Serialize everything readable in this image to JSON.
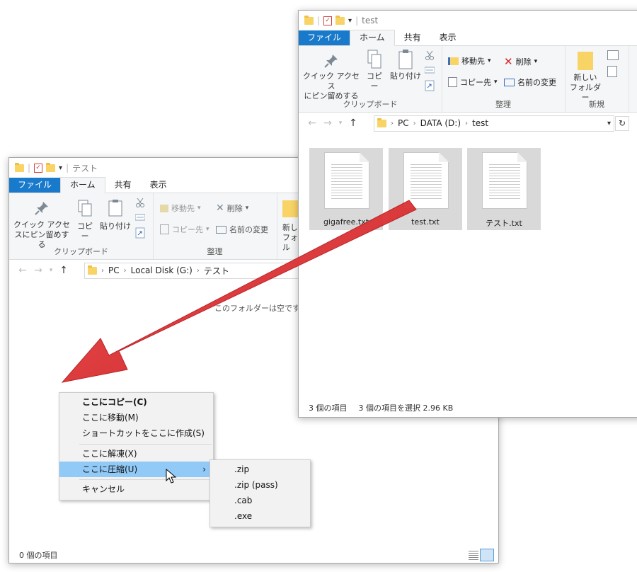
{
  "colors": {
    "file_tab": "#1979ca",
    "highlight": "#91c9f7",
    "arrow": "#e0262b",
    "folder": "#f8d467"
  },
  "back": {
    "title": "テスト",
    "tabs": [
      "ファイル",
      "ホーム",
      "共有",
      "表示"
    ],
    "ribbon": {
      "pin_label": "クイック アクセスにピン留めする",
      "copy_label": "コピー",
      "paste_label": "貼り付け",
      "clipboard_group": "クリップボード",
      "move_to": "移動先",
      "copy_to": "コピー先",
      "delete": "削除",
      "rename": "名前の変更",
      "organize_group": "整理",
      "new_folder_partial": "新し",
      "new_folder_partial2": "フォル"
    },
    "breadcrumb": [
      "PC",
      "Local Disk (G:)",
      "テスト"
    ],
    "empty_text": "このフォルダーは空です。",
    "status": "0 個の項目"
  },
  "front": {
    "title": "test",
    "tabs": [
      "ファイル",
      "ホーム",
      "共有",
      "表示"
    ],
    "ribbon": {
      "pin_label_1": "クイック アクセス",
      "pin_label_2": "にピン留めする",
      "copy_label": "コピー",
      "paste_label": "貼り付け",
      "clipboard_group": "クリップボード",
      "move_to": "移動先",
      "copy_to": "コピー先",
      "delete": "削除",
      "rename": "名前の変更",
      "organize_group": "整理",
      "new_folder_1": "新しい",
      "new_folder_2": "フォルダー",
      "new_group": "新規"
    },
    "breadcrumb": [
      "PC",
      "DATA (D:)",
      "test"
    ],
    "files": [
      "gigafree.txt",
      "test.txt",
      "テスト.txt"
    ],
    "status_count": "3 個の項目",
    "status_selected": "3 個の項目を選択  2.96 KB"
  },
  "context_menu": {
    "items": [
      "ここにコピー(C)",
      "ここに移動(M)",
      "ショートカットをここに作成(S)",
      "ここに解凍(X)",
      "ここに圧縮(U)",
      "キャンセル"
    ]
  },
  "submenu": {
    "items": [
      ".zip",
      ".zip (pass)",
      ".cab",
      ".exe"
    ]
  }
}
